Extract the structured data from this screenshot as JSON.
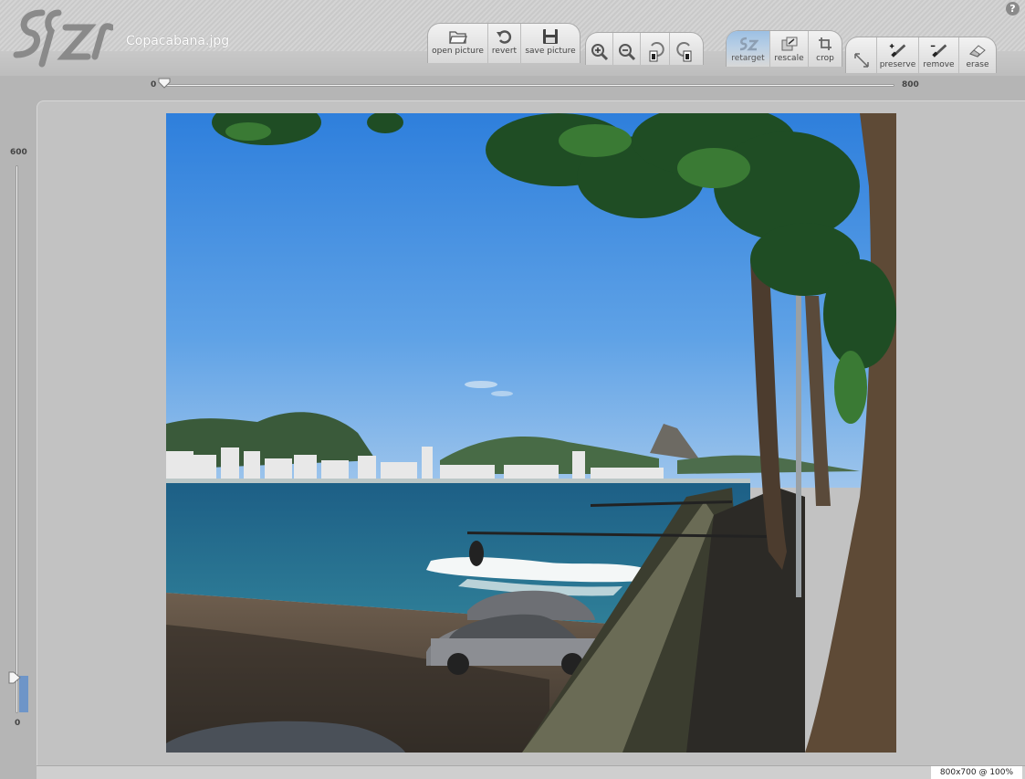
{
  "app": {
    "filename": "Copacabana.jpg",
    "help": "?"
  },
  "toolbar": {
    "file_group": [
      {
        "label": "open picture",
        "icon": "open-folder-icon"
      },
      {
        "label": "revert",
        "icon": "revert-icon"
      },
      {
        "label": "save picture",
        "icon": "floppy-icon"
      }
    ],
    "view_group": [
      {
        "icon": "zoom-in-icon"
      },
      {
        "icon": "zoom-out-icon"
      },
      {
        "icon": "rotate-left-icon"
      },
      {
        "icon": "rotate-right-icon"
      }
    ],
    "mode_group": [
      {
        "label": "retarget",
        "icon": "retarget-icon",
        "active": true
      },
      {
        "label": "rescale",
        "icon": "rescale-icon"
      },
      {
        "label": "crop",
        "icon": "crop-icon"
      }
    ],
    "brush_group": [
      {
        "icon": "expand-arrows-icon"
      },
      {
        "label": "preserve",
        "icon": "brush-plus-icon"
      },
      {
        "label": "remove",
        "icon": "brush-minus-icon"
      },
      {
        "label": "erase",
        "icon": "eraser-icon"
      }
    ]
  },
  "width_slider": {
    "min": "0",
    "max": "800",
    "value": 0
  },
  "height_slider": {
    "min": "0",
    "max": "600",
    "value": 0
  },
  "status": {
    "text": "800x700 @ 100%"
  },
  "colors": {
    "accent": "#6e95c8",
    "active_tab": "#9cc0e4"
  }
}
